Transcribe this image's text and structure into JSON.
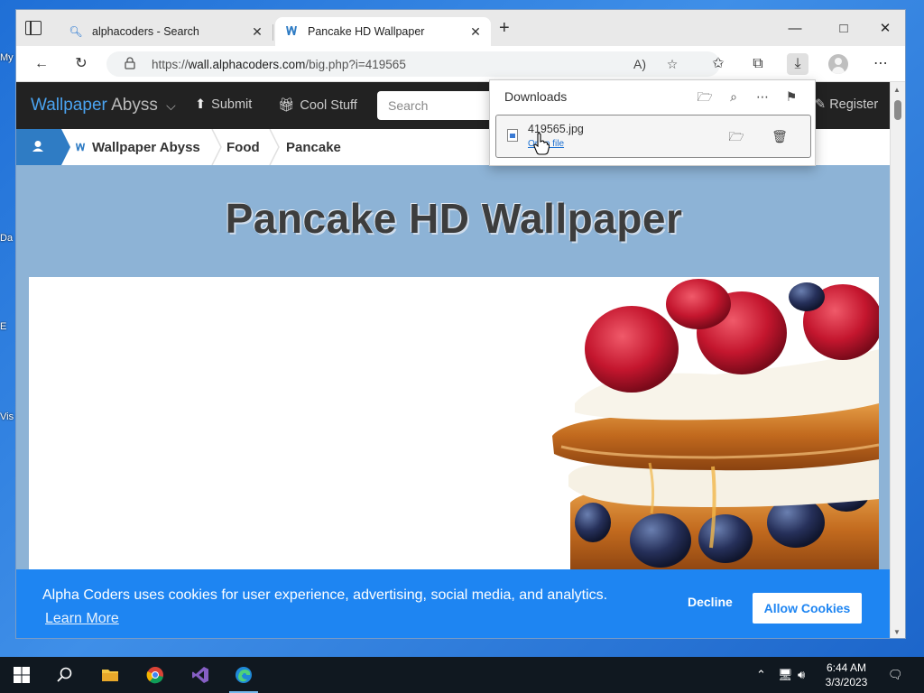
{
  "desktop": {
    "fragments": [
      "My",
      "Da",
      "E",
      "Vis"
    ]
  },
  "tabs": [
    {
      "title": "alphacoders - Search",
      "favicon": "search-icon"
    },
    {
      "title": "Pancake HD Wallpaper",
      "favicon": "wallpaper-abyss-logo-icon"
    }
  ],
  "address": {
    "url_prefix": "https://",
    "url_host": "wall.alphacoders.com",
    "url_path": "/big.php?i=419565"
  },
  "site": {
    "brand_primary": "Wallpaper",
    "brand_secondary": "Abyss",
    "nav_submit": "Submit",
    "nav_cool_stuff": "Cool Stuff",
    "search_placeholder": "Search",
    "register": "Register"
  },
  "breadcrumb": {
    "items": [
      "Wallpaper Abyss",
      "Food",
      "Pancake"
    ]
  },
  "page": {
    "title": "Pancake HD Wallpaper"
  },
  "cookie": {
    "message": "Alpha Coders uses cookies for user experience, advertising, social media, and analytics.",
    "learn_more": "Learn More",
    "decline": "Decline",
    "allow": "Allow Cookies"
  },
  "downloads": {
    "title": "Downloads",
    "file_name": "419565.jpg",
    "open_file": "Open file"
  },
  "taskbar": {
    "time": "6:44 AM",
    "date": "3/3/2023"
  },
  "colors": {
    "brand_blue": "#4aa3f0",
    "cookie_blue": "#1e85f2",
    "nav_dark": "#222222",
    "page_bg": "#8db3d6"
  }
}
